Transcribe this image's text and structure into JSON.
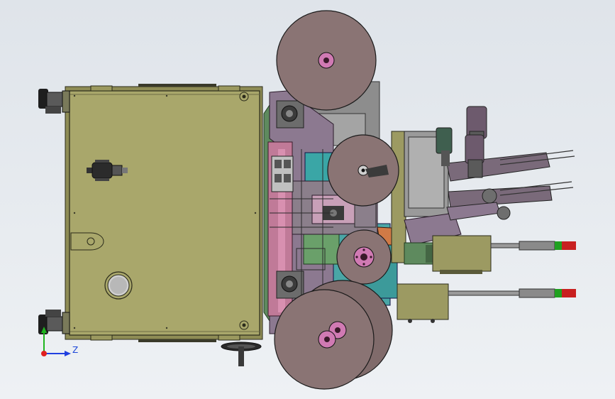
{
  "viewport": {
    "background_color": "#e6eaee",
    "triad_axis_label": "Z",
    "axis_colors": {
      "x": "#e02020",
      "y": "#1fb51f",
      "z": "#2040e0"
    }
  },
  "palette": {
    "cabinet": "#a8a66a",
    "reel": "#8a7474",
    "reel_hub": "#d07ab3",
    "frame_green": "#5e8a5e",
    "frame_pink": "#c07a98",
    "frame_cyan": "#3aa6a6",
    "frame_gray": "#8c8c8c",
    "purple": "#8a708a",
    "signal_red": "#c82020",
    "signal_green": "#20a020"
  }
}
